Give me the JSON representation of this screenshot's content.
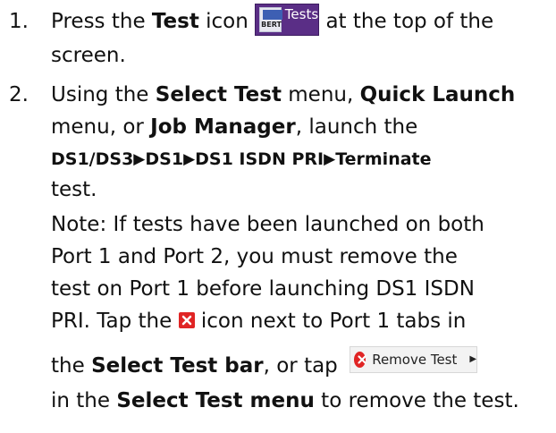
{
  "step1": {
    "number": "1.",
    "press": "Press the ",
    "test_bold": "Test",
    "icon_word": " icon ",
    "tests_icon": {
      "badge_text": "BERT",
      "label": "Tests"
    },
    "at_top": " at the top of the",
    "screen": "screen."
  },
  "step2": {
    "number": "2.",
    "using": "Using the ",
    "select_test": "Select Test",
    "menu_comma": " menu, ",
    "quick_launch": "Quick Launch",
    "menu_or": "menu, or ",
    "job_manager": "Job Manager",
    "launch_the": ", launch the",
    "path": [
      "DS1/DS3",
      "DS1",
      "DS1 ISDN PRI",
      "Terminate"
    ],
    "path_arrow": "▶",
    "test_word": "test.",
    "note_lines": [
      "Note: If tests have been launched on both",
      "Port 1 and Port 2, you must remove the",
      "test on Port 1 before launching DS1 ISDN"
    ],
    "pri_tap": "PRI.   Tap the ",
    "icon_next": " icon next to Port 1 tabs in",
    "the_word": "the ",
    "select_test_bar": "Select Test bar",
    "or_tap": ", or tap ",
    "remove_test_label": "Remove Test",
    "in_the": "in the ",
    "select_test_menu": "Select Test menu",
    "to_remove": " to remove the test."
  }
}
